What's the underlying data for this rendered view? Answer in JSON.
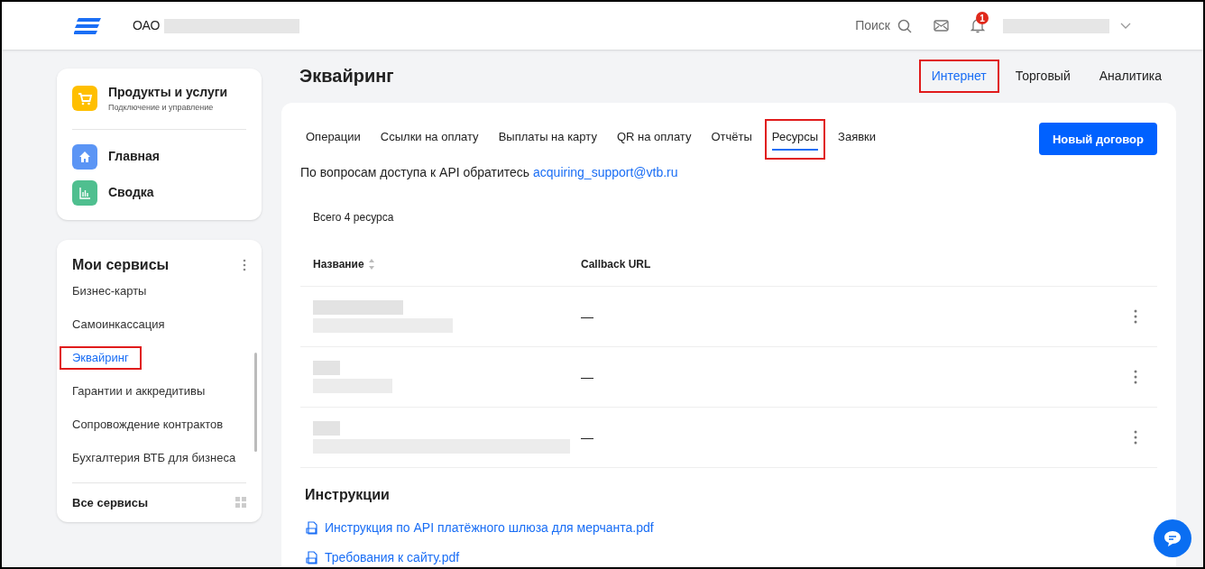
{
  "header": {
    "company": "ОАО",
    "search": "Поиск",
    "notifications_badge": "1"
  },
  "sidebar": {
    "products": {
      "title": "Продукты и услуги",
      "subtitle": "Подключение и управление"
    },
    "nav": [
      {
        "label": "Главная",
        "kind": "home"
      },
      {
        "label": "Сводка",
        "kind": "chart"
      }
    ],
    "services_title": "Мои сервисы",
    "services": [
      {
        "label": "Бизнес-карты",
        "selected": false,
        "highlighted": false
      },
      {
        "label": "Самоинкассация",
        "selected": false,
        "highlighted": false
      },
      {
        "label": "Эквайринг",
        "selected": true,
        "highlighted": true
      },
      {
        "label": "Гарантии и аккредитивы",
        "selected": false,
        "highlighted": false
      },
      {
        "label": "Сопровождение контрактов",
        "selected": false,
        "highlighted": false
      },
      {
        "label": "Бухгалтерия ВТБ для бизнеса",
        "selected": false,
        "highlighted": false
      }
    ],
    "all_services": "Все сервисы"
  },
  "page": {
    "title": "Эквайринг",
    "modes": [
      {
        "label": "Интернет",
        "selected": true,
        "highlighted": true
      },
      {
        "label": "Торговый",
        "selected": false,
        "highlighted": false
      },
      {
        "label": "Аналитика",
        "selected": false,
        "highlighted": false
      }
    ],
    "tabs": [
      {
        "label": "Операции",
        "selected": false,
        "highlighted": false
      },
      {
        "label": "Ссылки на оплату",
        "selected": false,
        "highlighted": false
      },
      {
        "label": "Выплаты на карту",
        "selected": false,
        "highlighted": false
      },
      {
        "label": "QR на оплату",
        "selected": false,
        "highlighted": false
      },
      {
        "label": "Отчёты",
        "selected": false,
        "highlighted": false
      },
      {
        "label": "Ресурсы",
        "selected": true,
        "highlighted": true
      },
      {
        "label": "Заявки",
        "selected": false,
        "highlighted": false
      }
    ],
    "new_contract_button": "Новый договор",
    "api_note": "По вопросам доступа к API обратитесь",
    "api_email": "acquiring_support@vtb.ru",
    "total": "Всего 4 ресурса",
    "table": {
      "columns": [
        "Название",
        "Callback URL"
      ],
      "rows": [
        {
          "callback_url": "—"
        },
        {
          "callback_url": "—"
        },
        {
          "callback_url": "—"
        }
      ]
    },
    "instructions_title": "Инструкции",
    "instructions": [
      "Инструкция по API платёжного шлюза для мерчанта.pdf",
      "Требования к сайту.pdf"
    ]
  }
}
